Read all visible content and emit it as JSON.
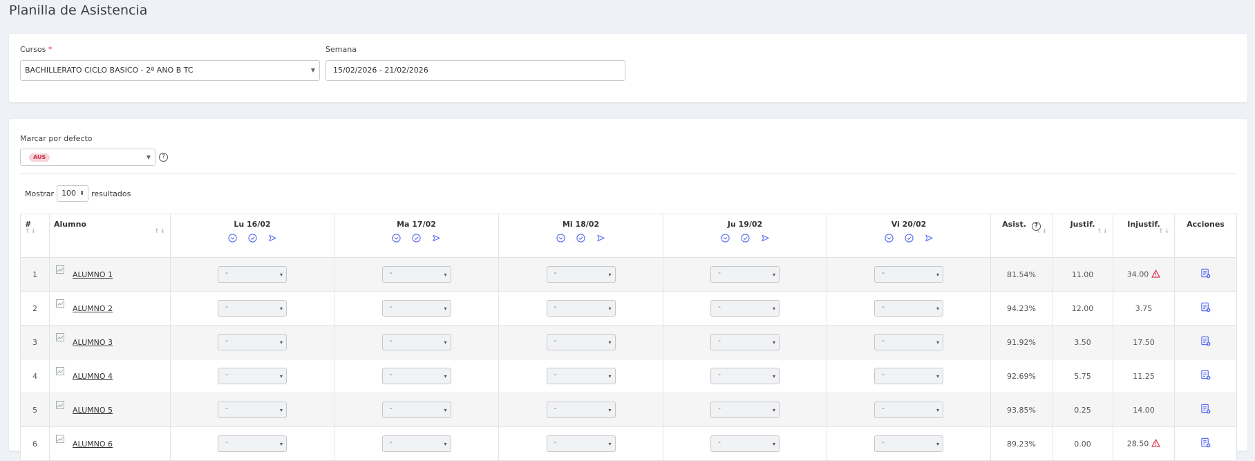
{
  "page": {
    "title": "Planilla de Asistencia"
  },
  "filters": {
    "cursos_label": "Cursos",
    "cursos_required": "*",
    "cursos_value": "BACHILLERATO CICLO BASICO - 2º ANO B TC",
    "semana_label": "Semana",
    "semana_value": "15/02/2026 - 21/02/2026"
  },
  "defaults": {
    "label": "Marcar por defecto",
    "badge": "AUS",
    "help": "?"
  },
  "pagination": {
    "show_label": "Mostrar",
    "page_size": "100",
    "results_label": "resultados"
  },
  "table": {
    "headers": {
      "num": "#",
      "alumno": "Alumno",
      "days": [
        "Lu 16/02",
        "Ma 17/02",
        "Mi 18/02",
        "Ju 19/02",
        "Vi 20/02"
      ],
      "asist": "Asist.",
      "justif": "Justif.",
      "injustif": "Injustif.",
      "acciones": "Acciones"
    },
    "select_placeholder": "-",
    "rows": [
      {
        "num": "1",
        "name": "ALUMNO 1",
        "asist": "81.54%",
        "justif": "11.00",
        "injustif": "34.00",
        "warning": true
      },
      {
        "num": "2",
        "name": "ALUMNO 2",
        "asist": "94.23%",
        "justif": "12.00",
        "injustif": "3.75",
        "warning": false
      },
      {
        "num": "3",
        "name": "ALUMNO 3",
        "asist": "91.92%",
        "justif": "3.50",
        "injustif": "17.50",
        "warning": false
      },
      {
        "num": "4",
        "name": "ALUMNO 4",
        "asist": "92.69%",
        "justif": "5.75",
        "injustif": "11.25",
        "warning": false
      },
      {
        "num": "5",
        "name": "ALUMNO 5",
        "asist": "93.85%",
        "justif": "0.25",
        "injustif": "14.00",
        "warning": false
      },
      {
        "num": "6",
        "name": "ALUMNO 6",
        "asist": "89.23%",
        "justif": "0.00",
        "injustif": "28.50",
        "warning": true
      }
    ]
  },
  "colors": {
    "accent": "#5a6cf0",
    "warning": "#e0334a",
    "badge_bg": "#f7d4da"
  },
  "icons": {
    "day_actions": [
      "chevron-circle-down-icon",
      "check-circle-icon",
      "send-icon"
    ],
    "row_action": "attendance-edit-icon",
    "warning": "warning-triangle-icon"
  }
}
